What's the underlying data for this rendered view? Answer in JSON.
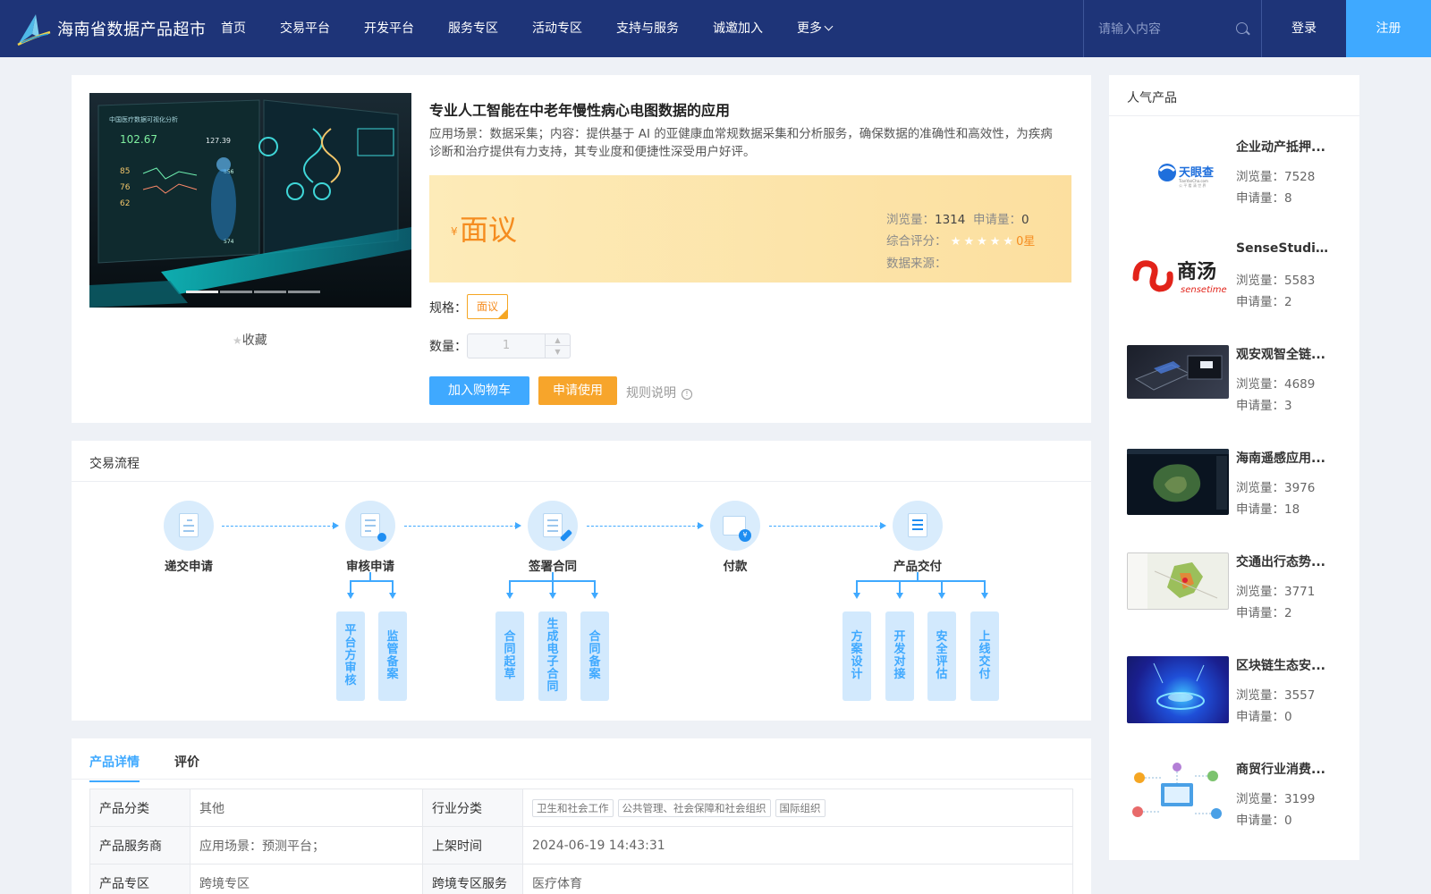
{
  "header": {
    "site_title": "海南省数据产品超市",
    "nav": [
      "首页",
      "交易平台",
      "开发平台",
      "服务专区",
      "活动专区",
      "支持与服务",
      "诚邀加入",
      "更多"
    ],
    "search_placeholder": "请输入内容",
    "login": "登录",
    "register": "注册",
    "colors": {
      "bar": "#1e3478",
      "accent": "#3fa9ff"
    }
  },
  "product": {
    "title": "专业人工智能在中老年慢性病心电图数据的应用",
    "description": "应用场景：数据采集；内容：提供基于 AI 的亚健康血常规数据采集和分析服务，确保数据的准确性和高效性，为疾病诊断和治疗提供有力支持，其专业度和便捷性深受用户好评。",
    "favorite": "收藏",
    "price_symbol": "¥",
    "price": "面议",
    "views_label": "浏览量：",
    "views": "1314",
    "applies_label": "申请量：",
    "applies": "0",
    "rating_label": "综合评分：",
    "rating_text": "0星",
    "rating_value": 0,
    "source_label": "数据来源：",
    "spec_label": "规格：",
    "spec_value": "面议",
    "qty_label": "数量：",
    "qty_value": "1",
    "add_cart": "加入购物车",
    "apply": "申请使用",
    "rule": "规则说明",
    "gallery_slides": 4,
    "gallery_active": 0,
    "gallery_texts": [
      "中国医疗数据可视化分析",
      "102.67",
      "127.39",
      "85",
      "76",
      "62",
      "856",
      "574"
    ]
  },
  "flow": {
    "title": "交易流程",
    "steps": [
      "递交申请",
      "审核申请",
      "签署合同",
      "付款",
      "产品交付"
    ],
    "sub_review": [
      "平台方审核",
      "监管备案"
    ],
    "sub_contract": [
      "合同起草",
      "生成电子合同",
      "合同备案"
    ],
    "sub_delivery": [
      "方案设计",
      "开发对接",
      "安全评估",
      "上线交付"
    ]
  },
  "details": {
    "tabs": [
      "产品详情",
      "评价"
    ],
    "rows": [
      {
        "k1": "产品分类",
        "v1": "其他",
        "k2": "行业分类",
        "tags": [
          "卫生和社会工作",
          "公共管理、社会保障和社会组织",
          "国际组织"
        ]
      },
      {
        "k1": "产品服务商",
        "v1": "应用场景：预测平台；",
        "k2": "上架时间",
        "v2": "2024-06-19 14:43:31"
      },
      {
        "k1": "产品专区",
        "v1": "跨境专区",
        "k2": "跨境专区服务",
        "v2": "医疗体育"
      }
    ]
  },
  "popular": {
    "title": "人气产品",
    "view_label": "浏览量：",
    "apply_label": "申请量：",
    "items": [
      {
        "title": "企业动产抵押...",
        "views": "7528",
        "applies": "8",
        "logo": "天眼查",
        "logo_sub": "TianYanCha.com",
        "logo_sub2": "公 平 看 清 世 界"
      },
      {
        "title": "SenseStudio...",
        "views": "5583",
        "applies": "2",
        "logo": "商汤",
        "logo_sub": "sensetime"
      },
      {
        "title": "观安观智全链...",
        "views": "4689",
        "applies": "3"
      },
      {
        "title": "海南遥感应用...",
        "views": "3976",
        "applies": "18"
      },
      {
        "title": "交通出行态势...",
        "views": "3771",
        "applies": "2"
      },
      {
        "title": "区块链生态安...",
        "views": "3557",
        "applies": "0"
      },
      {
        "title": "商贸行业消费...",
        "views": "3199",
        "applies": "0"
      }
    ]
  }
}
